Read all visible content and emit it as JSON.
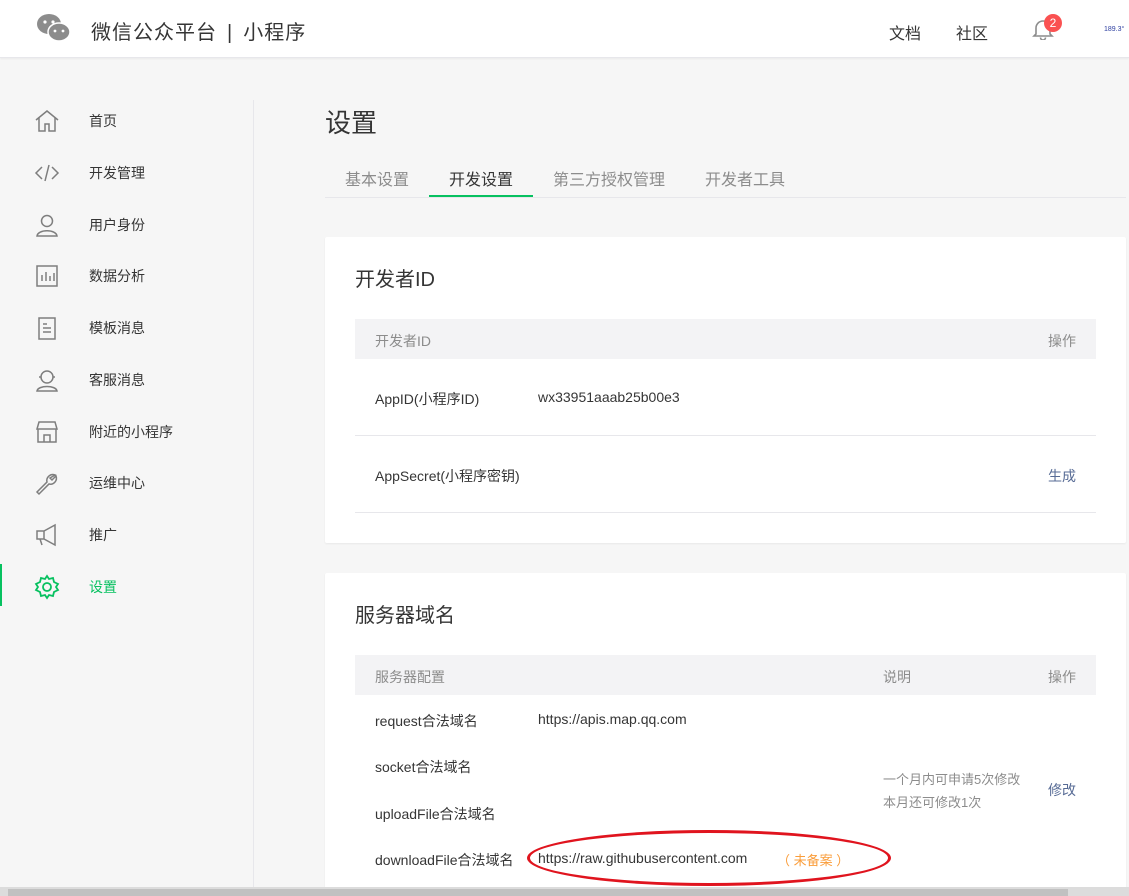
{
  "header": {
    "brand_left": "微信公众平台",
    "brand_sep": "|",
    "brand_right": "小程序",
    "links": [
      "文档",
      "社区"
    ],
    "notification_count": "2",
    "avatar_text": "189.3°"
  },
  "sidebar": {
    "items": [
      {
        "label": "首页",
        "icon": "home-icon"
      },
      {
        "label": "开发管理",
        "icon": "code-icon"
      },
      {
        "label": "用户身份",
        "icon": "user-icon"
      },
      {
        "label": "数据分析",
        "icon": "chart-icon"
      },
      {
        "label": "模板消息",
        "icon": "document-icon"
      },
      {
        "label": "客服消息",
        "icon": "support-icon"
      },
      {
        "label": "附近的小程序",
        "icon": "store-icon"
      },
      {
        "label": "运维中心",
        "icon": "wrench-icon"
      },
      {
        "label": "推广",
        "icon": "megaphone-icon"
      },
      {
        "label": "设置",
        "icon": "gear-icon"
      }
    ],
    "active": "设置"
  },
  "main": {
    "title": "设置",
    "tabs": [
      "基本设置",
      "开发设置",
      "第三方授权管理",
      "开发者工具"
    ],
    "active_tab": "开发设置",
    "developer_card": {
      "title": "开发者ID",
      "header": {
        "col1": "开发者ID",
        "action": "操作"
      },
      "appid_label": "AppID(小程序ID)",
      "appid_value": "wx33951aaab25b00e3",
      "secret_label": "AppSecret(小程序密钥)",
      "secret_action": "生成"
    },
    "server_card": {
      "title": "服务器域名",
      "header": {
        "col1": "服务器配置",
        "col2": "说明",
        "action": "操作"
      },
      "rows": [
        {
          "label": "request合法域名",
          "value": "https://apis.map.qq.com"
        },
        {
          "label": "socket合法域名",
          "value": ""
        },
        {
          "label": "uploadFile合法域名",
          "value": ""
        },
        {
          "label": "downloadFile合法域名",
          "value": "https://raw.githubusercontent.com",
          "note": "（ 未备案 ）"
        }
      ],
      "description_line1": "一个月内可申请5次修改",
      "description_line2": "本月还可修改1次",
      "action": "修改"
    }
  },
  "colors": {
    "accent": "#07c160",
    "link": "#576b95",
    "warning": "#fa9d3b",
    "annotation": "#e0141e"
  }
}
